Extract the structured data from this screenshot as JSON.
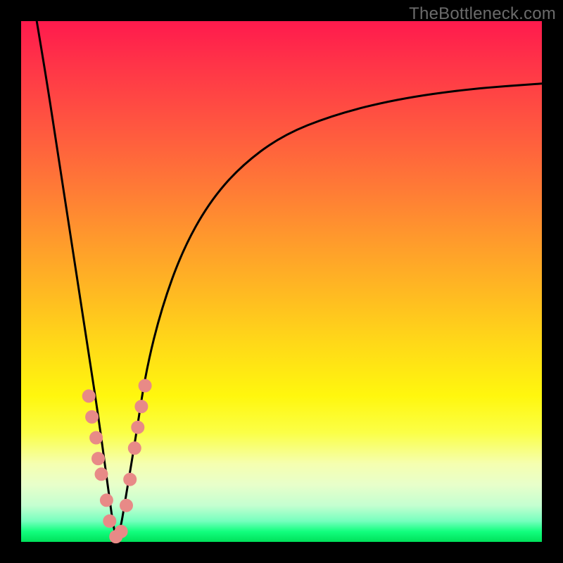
{
  "watermark": "TheBottleneck.com",
  "colors": {
    "gradient_top": "#ff1a4d",
    "gradient_mid": "#ffd918",
    "gradient_bottom": "#00e05a",
    "curve": "#000000",
    "dots": "#e88a87",
    "frame": "#000000"
  },
  "chart_data": {
    "type": "line",
    "title": "",
    "xlabel": "",
    "ylabel": "",
    "xlim": [
      0,
      100
    ],
    "ylim": [
      0,
      100
    ],
    "grid": false,
    "legend": false,
    "note": "Axes are unlabeled percentage scales inferred from the bottleneck graph. ylim 0 = green bottom, 100 = red top. Curve is V-shaped with minimum near x≈18.",
    "series": [
      {
        "name": "bottleneck-curve",
        "x": [
          3,
          5,
          7,
          9,
          11,
          13,
          15,
          17,
          18,
          19,
          20,
          22,
          24,
          27,
          31,
          36,
          42,
          50,
          60,
          72,
          86,
          100
        ],
        "y": [
          100,
          88,
          75,
          62,
          49,
          36,
          23,
          8,
          1,
          2,
          8,
          20,
          33,
          45,
          56,
          65,
          72,
          78,
          82,
          85,
          87,
          88
        ]
      }
    ],
    "markers": [
      {
        "name": "left-cluster",
        "x": 13.0,
        "y": 28
      },
      {
        "name": "left-cluster",
        "x": 13.6,
        "y": 24
      },
      {
        "name": "left-cluster",
        "x": 14.4,
        "y": 20
      },
      {
        "name": "left-cluster",
        "x": 14.8,
        "y": 16
      },
      {
        "name": "left-cluster",
        "x": 15.4,
        "y": 13
      },
      {
        "name": "left-cluster",
        "x": 16.4,
        "y": 8
      },
      {
        "name": "left-cluster",
        "x": 17.0,
        "y": 4
      },
      {
        "name": "bottom",
        "x": 18.2,
        "y": 1
      },
      {
        "name": "bottom",
        "x": 19.2,
        "y": 2
      },
      {
        "name": "right-cluster",
        "x": 20.2,
        "y": 7
      },
      {
        "name": "right-cluster",
        "x": 20.9,
        "y": 12
      },
      {
        "name": "right-cluster",
        "x": 21.8,
        "y": 18
      },
      {
        "name": "right-cluster",
        "x": 22.4,
        "y": 22
      },
      {
        "name": "right-cluster",
        "x": 23.1,
        "y": 26
      },
      {
        "name": "right-cluster",
        "x": 23.8,
        "y": 30
      }
    ]
  }
}
